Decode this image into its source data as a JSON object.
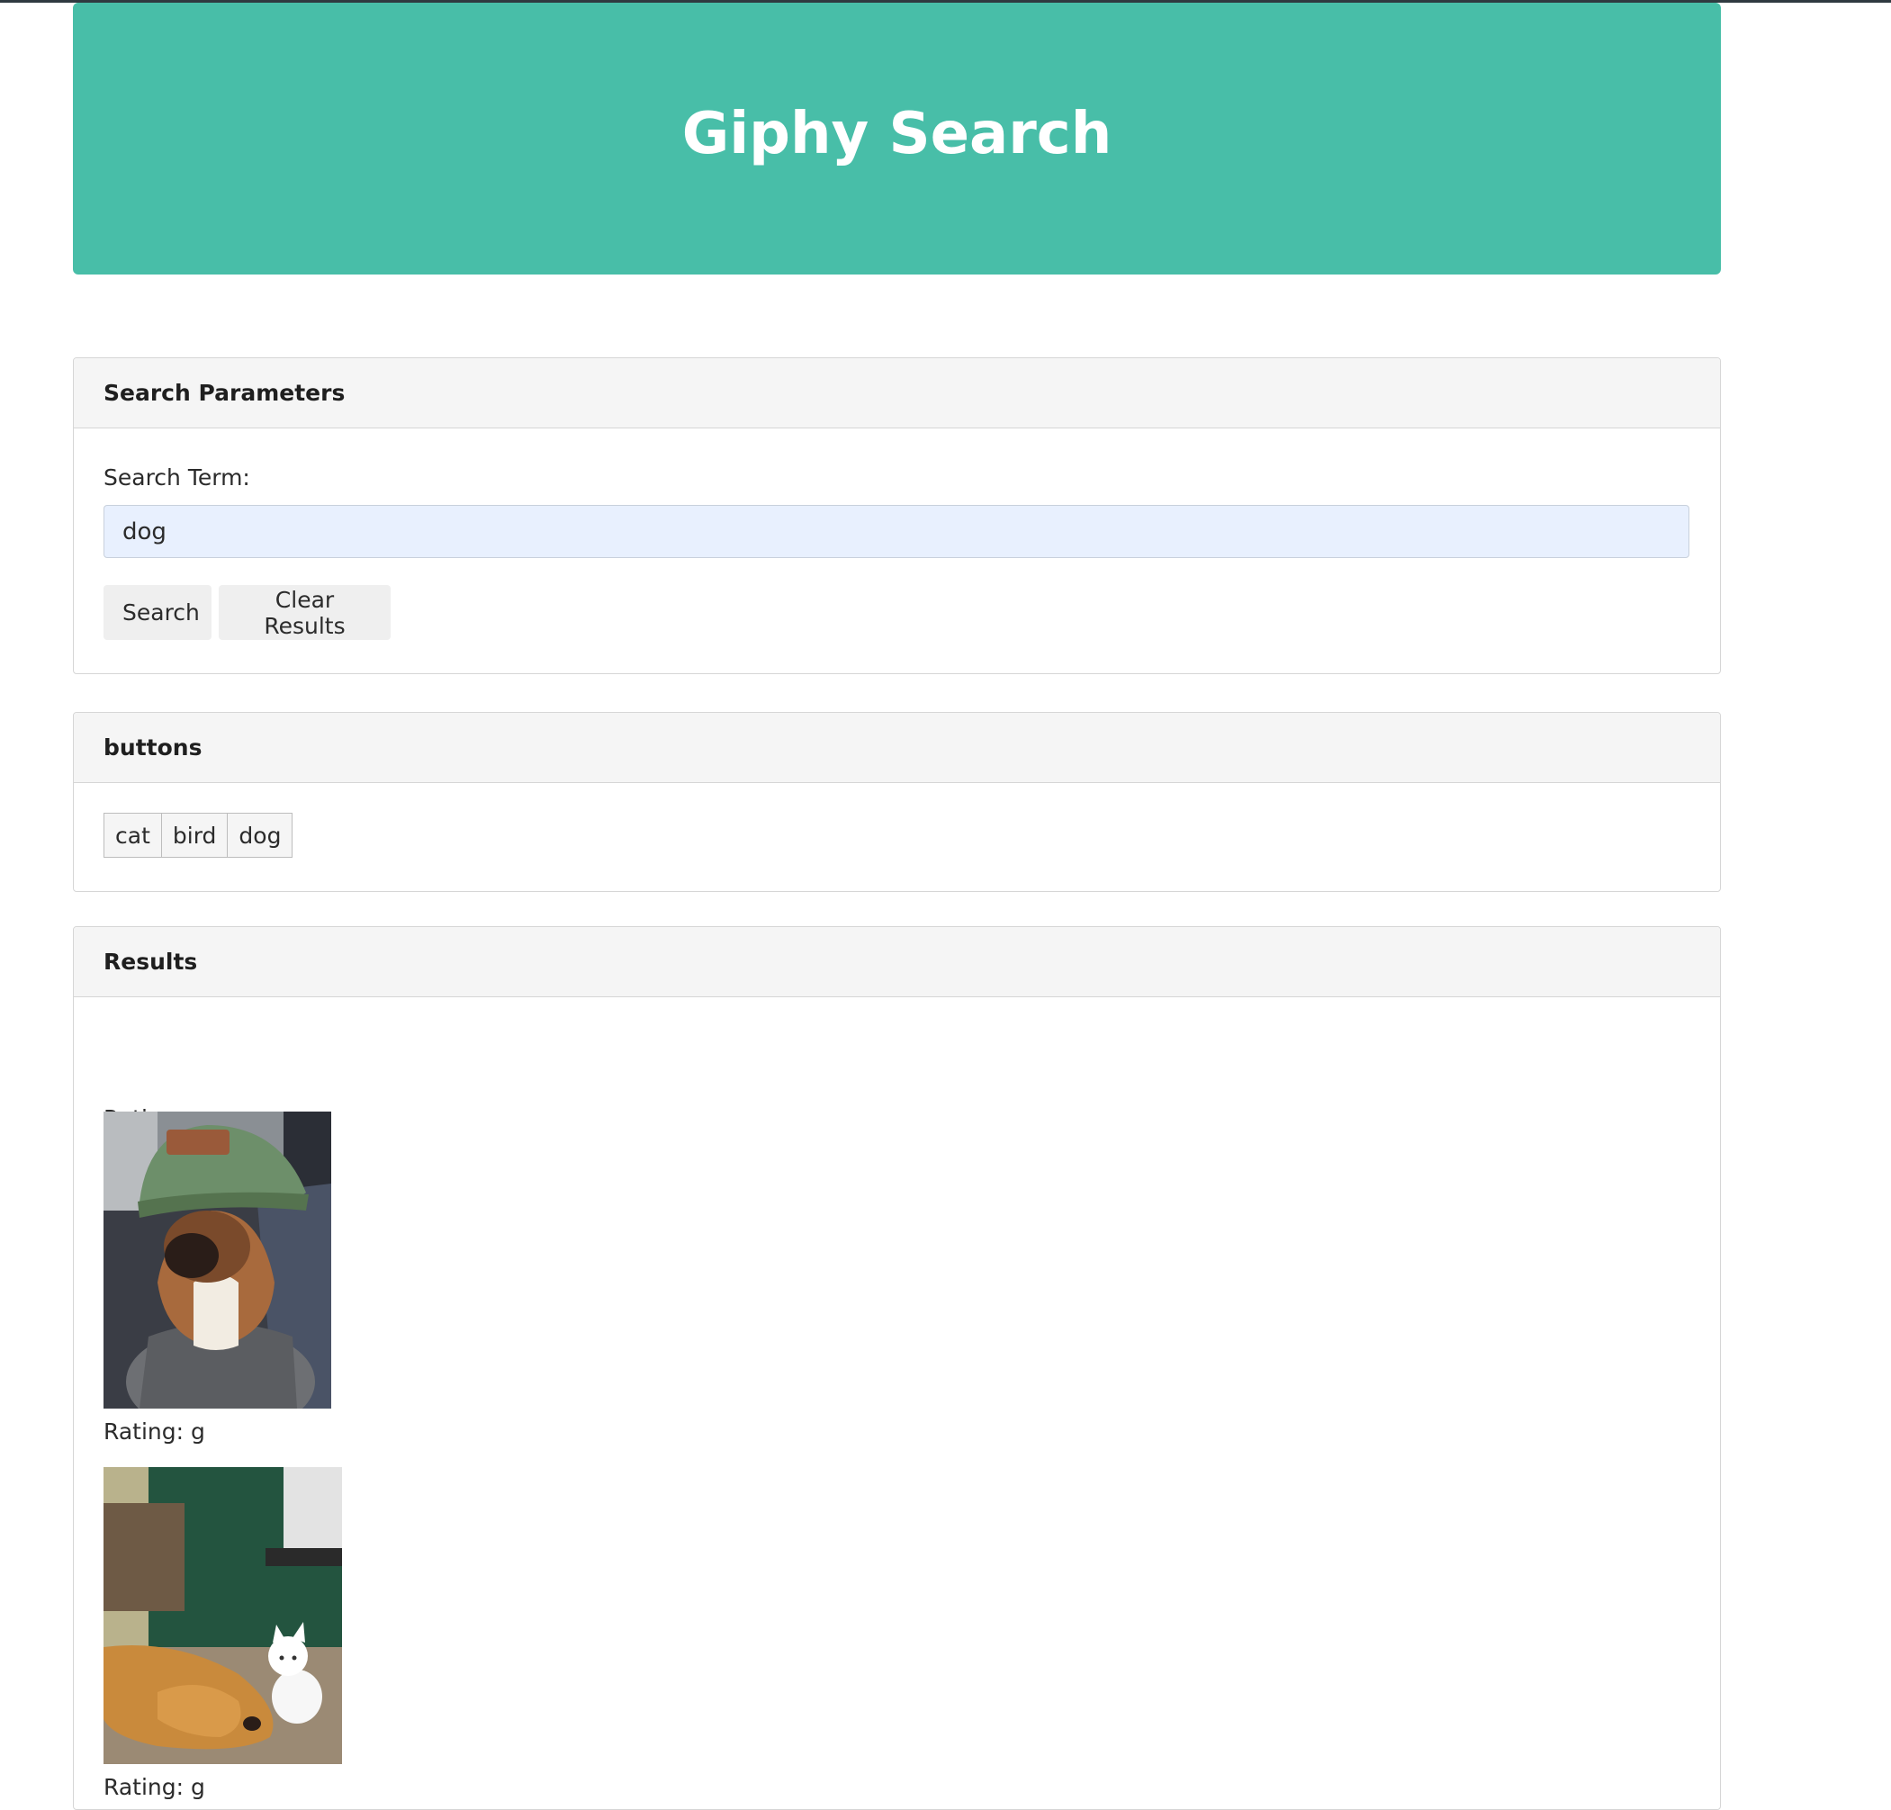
{
  "header": {
    "title": "Giphy Search"
  },
  "search_panel": {
    "title": "Search Parameters",
    "label": "Search Term:",
    "input_value": "dog",
    "search_button": "Search",
    "clear_button": "Clear Results"
  },
  "buttons_panel": {
    "title": "buttons",
    "buttons": [
      "cat",
      "bird",
      "dog"
    ]
  },
  "results_panel": {
    "title": "Results",
    "ratings": [
      "Rating: g",
      "Rating: g",
      "Rating: g"
    ],
    "gifs": [
      {
        "subject": "boxer-dog-wearing-green-beanie-image"
      },
      {
        "subject": "golden-retriever-with-white-kitten-image"
      }
    ]
  },
  "colors": {
    "jumbotron": "#48bea8",
    "panel_heading": "#f5f5f5",
    "input_autofill": "#e8f0fe",
    "button": "#efefef"
  }
}
